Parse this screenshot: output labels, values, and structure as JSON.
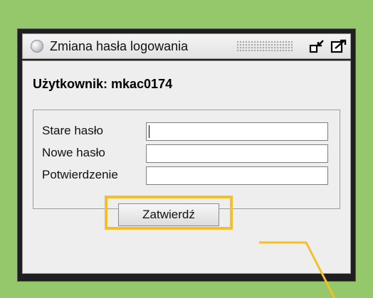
{
  "window": {
    "title": "Zmiana hasła logowania",
    "icons": {
      "menu": "circle-icon",
      "minimize": "minimize-icon",
      "maximize": "maximize-icon"
    }
  },
  "form": {
    "user_label": "Użytkownik: mkac0174",
    "fields": [
      {
        "label": "Stare hasło",
        "value": "",
        "placeholder": ""
      },
      {
        "label": "Nowe hasło",
        "value": "",
        "placeholder": ""
      },
      {
        "label": "Potwierdzenie",
        "value": "",
        "placeholder": ""
      }
    ],
    "submit_label": "Zatwierdź"
  },
  "colors": {
    "background": "#94c86a",
    "highlight": "#f3c02c",
    "window_frame": "#1f1f1f",
    "content_bg": "#eeeeee"
  }
}
